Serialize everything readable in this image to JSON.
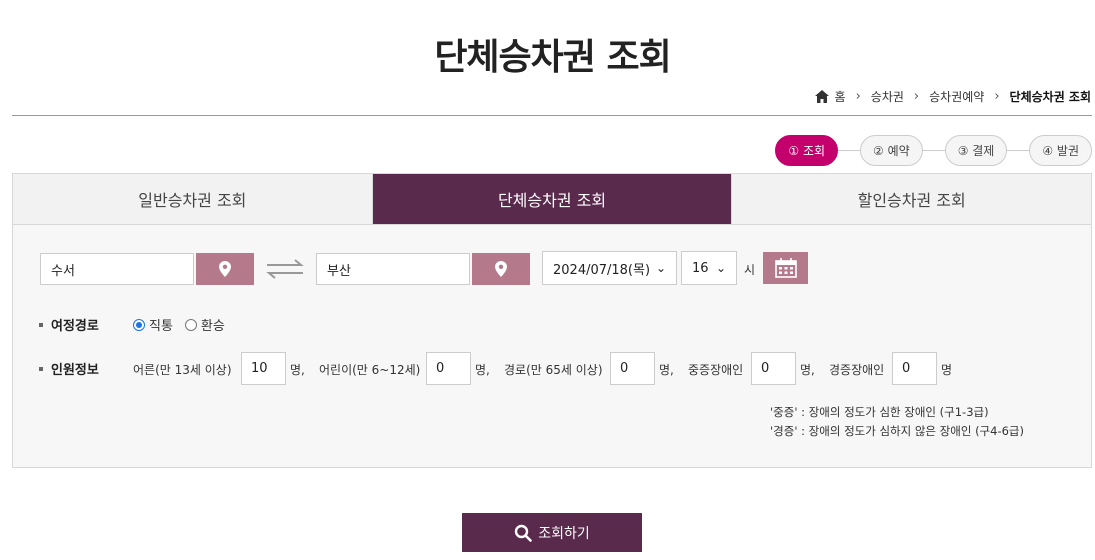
{
  "page": {
    "title": "단체승차권 조회"
  },
  "breadcrumb": [
    "홈",
    "승차권",
    "승차권예약",
    "단체승차권 조회"
  ],
  "steps": [
    "① 조회",
    "② 예약",
    "③ 결제",
    "④ 발권"
  ],
  "tabs": [
    "일반승차권 조회",
    "단체승차권 조회",
    "할인승차권 조회"
  ],
  "search": {
    "departure": "수서",
    "arrival": "부산",
    "date": "2024/07/18(목)",
    "hour": "16",
    "hour_unit": "시"
  },
  "route": {
    "label": "여정경로",
    "options": [
      "직통",
      "환승"
    ],
    "selected": "직통"
  },
  "passengers": {
    "label": "인원정보",
    "unit": "명,",
    "last_unit": "명",
    "items": [
      {
        "label": "어른(만 13세 이상)",
        "value": "10"
      },
      {
        "label": "어린이(만 6~12세)",
        "value": "0"
      },
      {
        "label": "경로(만 65세 이상)",
        "value": "0"
      },
      {
        "label": "중증장애인",
        "value": "0"
      },
      {
        "label": "경증장애인",
        "value": "0"
      }
    ]
  },
  "notes": [
    "'중증' : 장애의 정도가 심한 장애인 (구1-3급)",
    "'경증' : 장애의 정도가 심하지 않은 장애인 (구4-6급)"
  ],
  "submit_label": "조회하기",
  "colors": {
    "accent": "#5a2a4d",
    "step_active": "#c4006d",
    "icon_button": "#b47a8c"
  }
}
